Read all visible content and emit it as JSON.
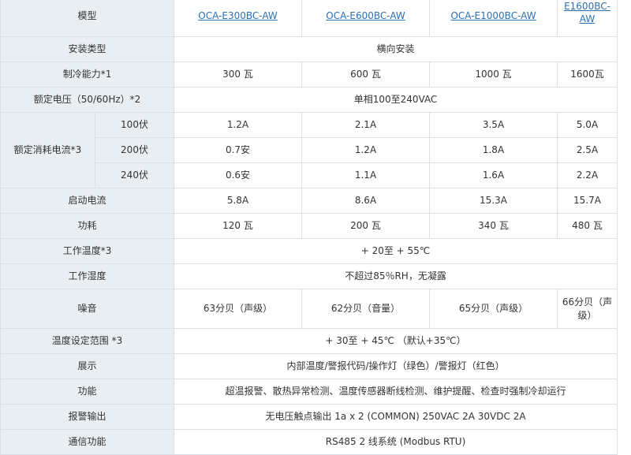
{
  "header": {
    "label": "模型",
    "models": [
      "OCA-E300BC-AW",
      "OCA-E600BC-AW",
      "OCA-E1000BC-AW",
      "E1600BC-AW"
    ]
  },
  "rows": {
    "install": {
      "label": "安装类型",
      "value": "横向安装"
    },
    "cooling": {
      "label": "制冷能力*1",
      "values": [
        "300 瓦",
        "600 瓦",
        "1000 瓦",
        "1600瓦"
      ]
    },
    "voltage": {
      "label": "额定电压（50/60Hz）*2",
      "value": "单相100至240VAC"
    },
    "current": {
      "label": "额定消耗电流*3",
      "sub": [
        {
          "label": "100伏",
          "values": [
            "1.2A",
            "2.1A",
            "3.5A",
            "5.0A"
          ]
        },
        {
          "label": "200伏",
          "values": [
            "0.7安",
            "1.2A",
            "1.8A",
            "2.5A"
          ]
        },
        {
          "label": "240伏",
          "values": [
            "0.6安",
            "1.1A",
            "1.6A",
            "2.2A"
          ]
        }
      ]
    },
    "startup": {
      "label": "启动电流",
      "values": [
        "5.8A",
        "8.6A",
        "15.3A",
        "15.7A"
      ]
    },
    "power": {
      "label": "功耗",
      "values": [
        "120 瓦",
        "200 瓦",
        "340 瓦",
        "480 瓦"
      ]
    },
    "op_temp": {
      "label": "工作温度*3",
      "value": "+ 20至 + 55℃"
    },
    "op_humid": {
      "label": "工作湿度",
      "value": "不超过85％RH，无凝露"
    },
    "noise": {
      "label": "噪音",
      "values": [
        "63分贝（声级）",
        "62分贝（音量）",
        "65分贝（声级）",
        "66分贝（声级）"
      ]
    },
    "temp_range": {
      "label": "温度设定范围 *3",
      "value": "+ 30至 + 45℃ （默认+35℃）"
    },
    "display": {
      "label": "展示",
      "value": "内部温度/警报代码/操作灯（绿色）/警报灯（红色）"
    },
    "function": {
      "label": "功能",
      "value": "超温报警、散热异常检测、温度传感器断线检测、维护提醒、检查时强制冷却运行"
    },
    "alarm": {
      "label": "报警输出",
      "value": "无电压触点输出 1a x 2 (COMMON) 250VAC 2A 30VDC 2A"
    },
    "comm": {
      "label": "通信功能",
      "value": "RS485 2 线系统 (Modbus RTU)"
    }
  }
}
